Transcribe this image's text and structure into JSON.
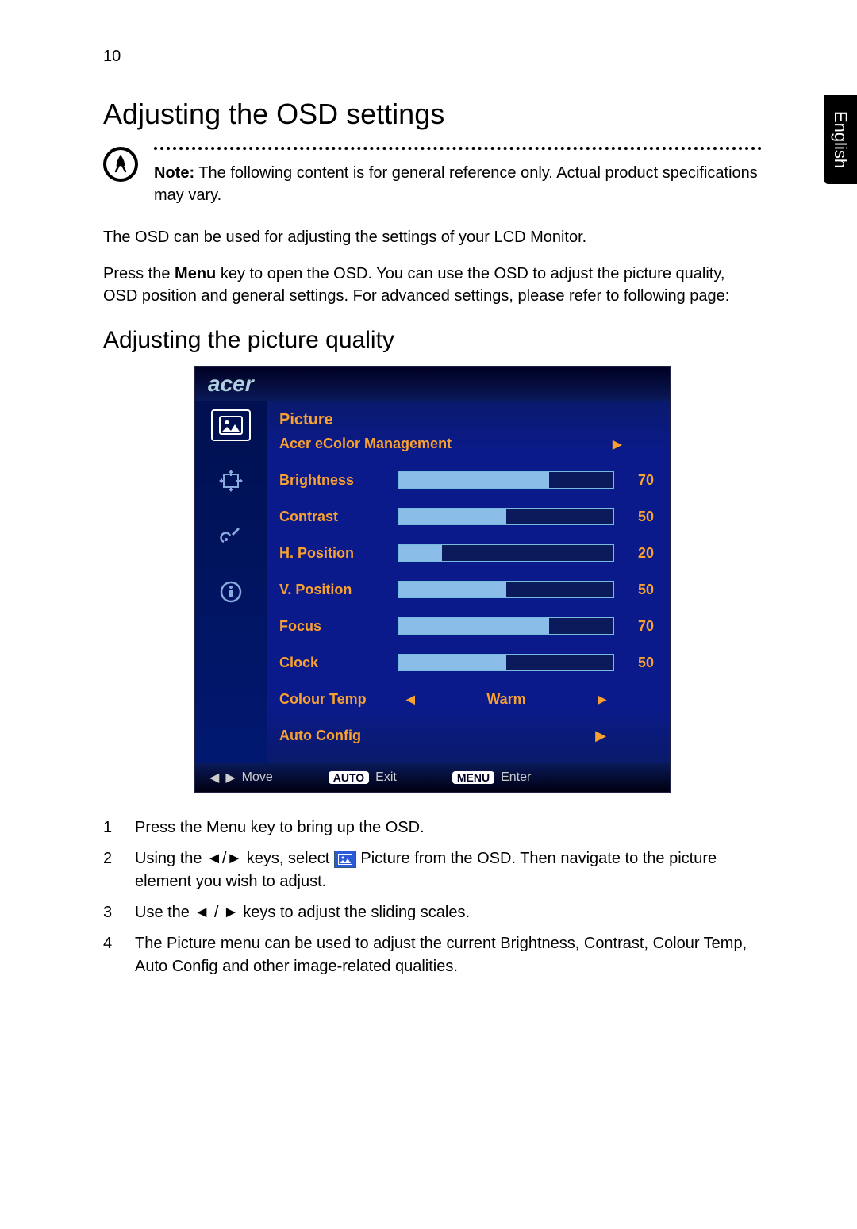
{
  "page_number": "10",
  "language_tab": "English",
  "h1": "Adjusting the OSD settings",
  "note": {
    "label": "Note:",
    "text": " The following content is for general reference only. Actual product specifications may vary."
  },
  "para1": "The OSD can be used for adjusting the settings of your LCD Monitor.",
  "para2a": "Press the ",
  "para2b": "Menu",
  "para2c": " key to open the OSD. You can use the OSD to adjust the picture quality, OSD position and general settings. For advanced settings, please refer to following page:",
  "h2": "Adjusting the picture quality",
  "osd": {
    "brand": "acer",
    "title": "Picture",
    "subtitle": "Acer eColor Management",
    "items": [
      {
        "label": "Brightness",
        "value": 70
      },
      {
        "label": "Contrast",
        "value": 50
      },
      {
        "label": "H. Position",
        "value": 20
      },
      {
        "label": "V. Position",
        "value": 50
      },
      {
        "label": "Focus",
        "value": 70
      },
      {
        "label": "Clock",
        "value": 50
      }
    ],
    "colour_temp_label": "Colour Temp",
    "colour_temp_value": "Warm",
    "auto_config_label": "Auto Config",
    "footer": {
      "move": "Move",
      "exit_pill": "AUTO",
      "exit": "Exit",
      "enter_pill": "MENU",
      "enter": "Enter"
    },
    "tab_names": [
      "picture-icon",
      "position-icon",
      "settings-icon",
      "info-icon"
    ]
  },
  "steps": {
    "s1": "Press the Menu key to bring up the OSD.",
    "s2a": "Using the ",
    "s2b": " keys, select ",
    "s2c": " Picture from the OSD. Then navigate to the picture element you wish to adjust.",
    "s3a": "Use the ",
    "s3b": " keys to adjust the sliding scales.",
    "s4": "The Picture menu can be used to adjust the current Brightness, Contrast, Colour Temp, Auto Config and other image-related qualities."
  },
  "glyphs": {
    "lr": "◄/►",
    "lr_spaced": "◄ / ►"
  }
}
